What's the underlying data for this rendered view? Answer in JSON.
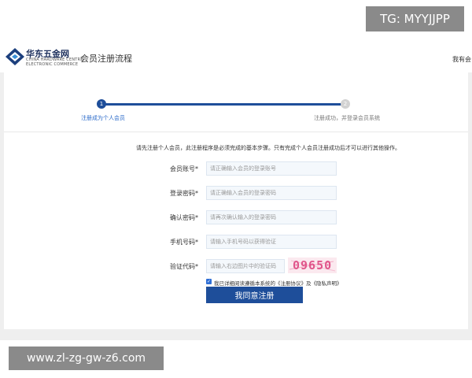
{
  "watermark_top": "TG: MYYJJPP",
  "watermark_bottom": "www.zl-zg-gw-z6.com",
  "header": {
    "logo_name": "华东五金网",
    "logo_sub_line1": "CHINA HARDWARE CENTRE",
    "logo_sub_line2": "ELECTRONIC COMMERCE",
    "title": "会员注册流程",
    "right_link": "我有会"
  },
  "progress": {
    "step1_number": "1",
    "step2_number": "2",
    "step1_label": "注册成为个人会员",
    "step2_label": "注册成功，并登录会员系统"
  },
  "notice": "请先注册个人会员，此注册程序是必须完成的基本步骤。只有完成个人会员注册成功后才可以进行其他操作。",
  "form": {
    "account_label": "会员账号*",
    "account_placeholder": "请正确输入会员的登录账号",
    "password_label": "登录密码*",
    "password_placeholder": "请正确输入会员的登录密码",
    "confirm_label": "确认密码*",
    "confirm_placeholder": "请再次确认输入的登录密码",
    "phone_label": "手机号码*",
    "phone_placeholder": "请输入手机号码以获得验证",
    "captcha_label": "验证代码*",
    "captcha_placeholder": "请输入右边图片中的验证码",
    "captcha_text": "09650",
    "agree_check": "✓",
    "agree_text": "我已详细阅读遵循本系统的《注册协议》及《隐私声明》",
    "submit_label": "我同意注册"
  },
  "colors": {
    "primary": "#1e4e9a",
    "link": "#2a6ac9",
    "captcha": "#e0548a"
  }
}
